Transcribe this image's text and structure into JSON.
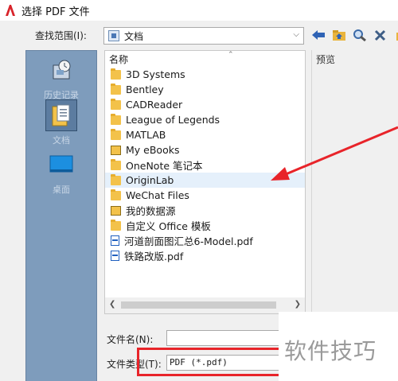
{
  "window": {
    "title": "选择 PDF 文件"
  },
  "lookin": {
    "label": "查找范围(I):",
    "value": "文档"
  },
  "places": [
    {
      "label": "历史记录",
      "icon": "history-icon"
    },
    {
      "label": "文档",
      "icon": "documents-icon",
      "selected": true
    },
    {
      "label": "桌面",
      "icon": "desktop-icon"
    }
  ],
  "list": {
    "header": "名称",
    "items": [
      {
        "name": "3D Systems",
        "type": "folder"
      },
      {
        "name": "Bentley",
        "type": "folder"
      },
      {
        "name": "CADReader",
        "type": "folder"
      },
      {
        "name": "League of Legends",
        "type": "folder"
      },
      {
        "name": "MATLAB",
        "type": "folder"
      },
      {
        "name": "My eBooks",
        "type": "special-folder"
      },
      {
        "name": "OneNote 笔记本",
        "type": "folder"
      },
      {
        "name": "OriginLab",
        "type": "folder"
      },
      {
        "name": "WeChat Files",
        "type": "folder"
      },
      {
        "name": "我的数据源",
        "type": "special-folder"
      },
      {
        "name": "自定义 Office 模板",
        "type": "folder"
      },
      {
        "name": "河道剖面图汇总6-Model.pdf",
        "type": "pdf"
      },
      {
        "name": "铁路改版.pdf",
        "type": "pdf"
      }
    ]
  },
  "preview": {
    "label": "预览"
  },
  "filename": {
    "label": "文件名(N):",
    "value": ""
  },
  "filetype": {
    "label": "文件类型(T):",
    "value": "PDF (*.pdf)"
  },
  "watermark": "软件技巧",
  "colors": {
    "annotation_red": "#e8242a",
    "places_bar": "#7e9cbc"
  }
}
